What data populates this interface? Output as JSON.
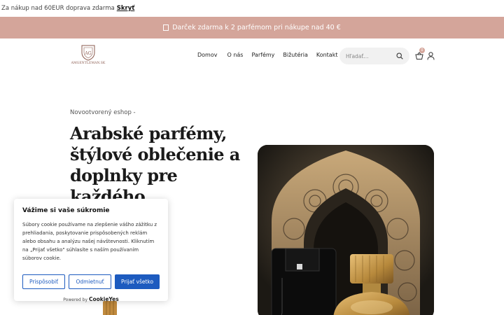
{
  "topbar": {
    "text": "Za nákup nad 60EUR doprava zdarma",
    "hide_label": "Skryť"
  },
  "promo": {
    "icon": "gift-icon",
    "text": "Darček zdarma k 2 parfémom pri nákupe nad 40 €"
  },
  "header": {
    "logo_text": "AMGENTLEMAN.SK",
    "nav": [
      {
        "label": "Domov"
      },
      {
        "label": "O nás"
      },
      {
        "label": "Parfémy"
      },
      {
        "label": "Bižutéria"
      },
      {
        "label": "Kontakt"
      }
    ],
    "search": {
      "placeholder": "Hľadať..."
    },
    "cart": {
      "count": "0",
      "icon": "basket-icon"
    },
    "account_icon": "user-icon"
  },
  "hero": {
    "eyebrow": "Novootvorený eshop -",
    "title": "Arabské parfémy, štýlové oblečenie a doplnky pre každého"
  },
  "cookie": {
    "title": "Vážime si vaše súkromie",
    "text": "Súbory cookie používame na zlepšenie vášho zážitku z prehliadania, poskytovanie prispôsobených reklám alebo obsahu a analýzu našej návštevnosti. Kliknutím na „Prijať všetko\" súhlasíte s naším používaním súborov cookie.",
    "btn_customize": "Prispôsobiť",
    "btn_reject": "Odmietnuť",
    "btn_accept": "Prijať všetko",
    "powered_by": "Powered by",
    "brand": "CookieYes"
  },
  "colors": {
    "accent": "#d4a59a",
    "button_blue": "#1d5bbf"
  }
}
